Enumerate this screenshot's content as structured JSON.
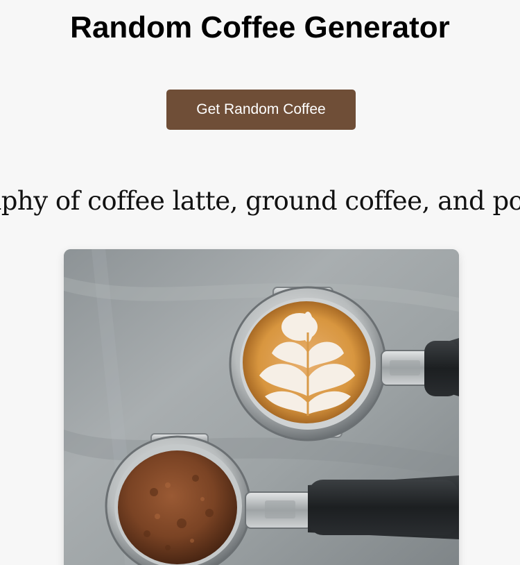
{
  "header": {
    "title": "Random Coffee Generator"
  },
  "actions": {
    "random_button_label": "Get Random Coffee"
  },
  "result": {
    "caption": "Photography of coffee latte, ground coffee, and portafilters",
    "image_alt": "latte and ground coffee in portafilters on steel counter"
  },
  "colors": {
    "button": "#6f4e37",
    "background": "#f7f7f7"
  }
}
